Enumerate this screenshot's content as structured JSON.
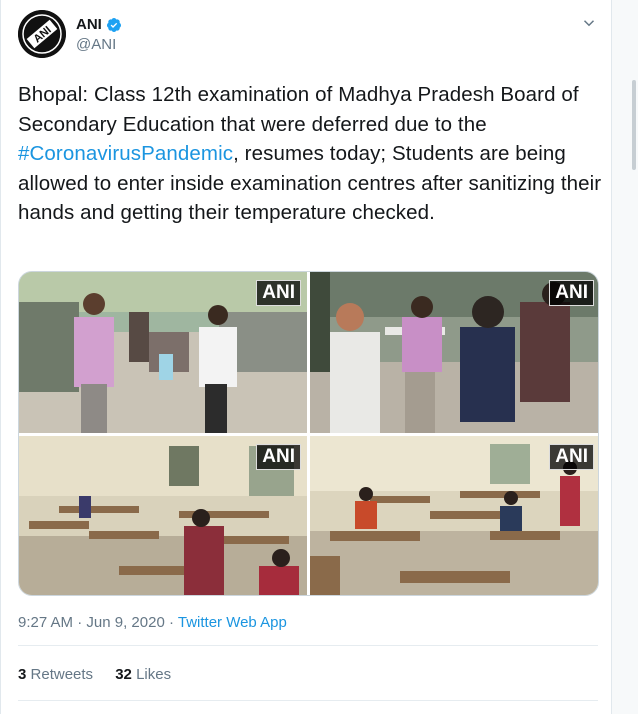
{
  "author": {
    "display_name": "ANI",
    "handle": "@ANI",
    "avatar_text": "ANI"
  },
  "tweet": {
    "text_before": "Bhopal: Class 12th examination of Madhya Pradesh Board of Secondary Education that were deferred due to the ",
    "hashtag": "#CoronavirusPandemic",
    "text_after": ", resumes today; Students are being allowed to enter inside examination centres after sanitizing their hands and getting their temperature checked."
  },
  "media": {
    "watermark": "ANI",
    "photos": [
      {
        "position": "top-left",
        "watermark": "ANI"
      },
      {
        "position": "top-right",
        "watermark": "ANI"
      },
      {
        "position": "bottom-left",
        "watermark": "ANI"
      },
      {
        "position": "bottom-right",
        "watermark": "ANI"
      }
    ]
  },
  "meta": {
    "time": "9:27 AM",
    "separator": " · ",
    "date": "Jun 9, 2020",
    "separator2": " · ",
    "source": "Twitter Web App"
  },
  "stats": {
    "retweets_count": "3",
    "retweets_label": "Retweets",
    "likes_count": "32",
    "likes_label": "Likes"
  },
  "colors": {
    "link": "#1b95e0",
    "secondary_text": "#657786",
    "verified": "#1da1f2"
  },
  "icons": {
    "verified": "verified-badge-icon",
    "caret": "chevron-down-icon"
  }
}
